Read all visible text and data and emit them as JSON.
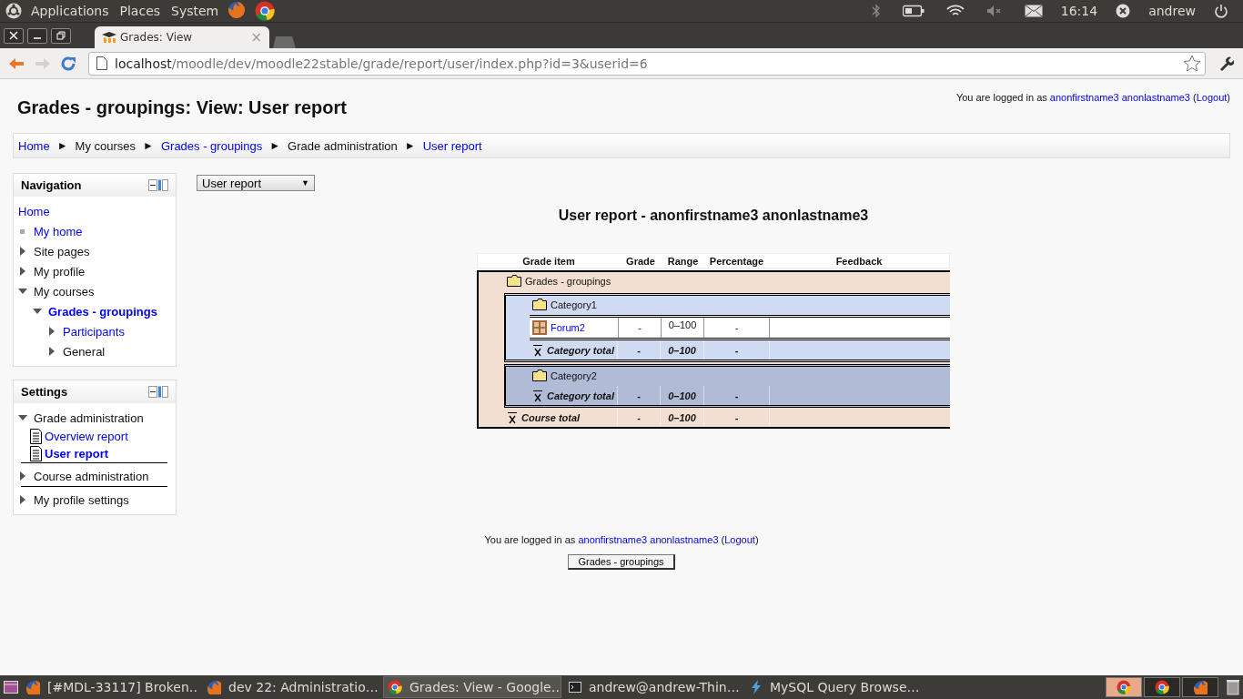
{
  "top_panel": {
    "menus": [
      "Applications",
      "Places",
      "System"
    ],
    "clock": "16:14",
    "user": "andrew"
  },
  "browser": {
    "tab_title": "Grades: View",
    "tab_close": "×",
    "url_host": "localhost",
    "url_path": "/moodle/dev/moodle22stable/grade/report/user/index.php?id=3&userid=6"
  },
  "page": {
    "title": "Grades - groupings: View: User report",
    "login": {
      "before": "You are logged in as ",
      "name": "anonfirstname3 anonlastname3",
      "open": " (",
      "logout": "Logout",
      "close": ")"
    },
    "breadcrumb": {
      "separator": "►",
      "items": [
        {
          "label": "Home",
          "link": true
        },
        {
          "label": "My courses",
          "link": false
        },
        {
          "label": "Grades - groupings",
          "link": true
        },
        {
          "label": "Grade administration",
          "link": false
        },
        {
          "label": "User report",
          "link": true
        }
      ]
    },
    "blocks": [
      {
        "title": "Navigation",
        "dividers": false,
        "items": [
          {
            "label": "Home",
            "kind": "plain",
            "link": true,
            "current": false
          },
          {
            "label": "My home",
            "kind": "leaf",
            "link": true,
            "current": false
          },
          {
            "label": "Site pages",
            "kind": "branch",
            "expanded": false,
            "link": false,
            "current": false
          },
          {
            "label": "My profile",
            "kind": "branch",
            "expanded": false,
            "link": false,
            "current": false
          },
          {
            "label": "My courses",
            "kind": "branch",
            "expanded": true,
            "link": false,
            "current": false,
            "children": [
              {
                "label": "Grades - groupings",
                "kind": "branch",
                "expanded": true,
                "link": true,
                "current": true,
                "children": [
                  {
                    "label": "Participants",
                    "kind": "branch",
                    "expanded": false,
                    "link": true,
                    "current": false
                  },
                  {
                    "label": "General",
                    "kind": "branch",
                    "expanded": false,
                    "link": false,
                    "current": false
                  }
                ]
              }
            ]
          }
        ]
      },
      {
        "title": "Settings",
        "dividers": true,
        "items": [
          {
            "label": "Grade administration",
            "kind": "branch",
            "expanded": true,
            "link": false,
            "current": false,
            "children": [
              {
                "label": "Overview report",
                "kind": "report",
                "link": true,
                "current": false
              },
              {
                "label": "User report",
                "kind": "report",
                "link": true,
                "current": true
              }
            ]
          },
          {
            "label": "Course administration",
            "kind": "branch",
            "expanded": false,
            "link": false,
            "current": false
          },
          {
            "label": "My profile settings",
            "kind": "branch",
            "expanded": false,
            "link": false,
            "current": false
          }
        ]
      }
    ],
    "report_select": {
      "value": "User report",
      "caret": "▼"
    },
    "heading": "User report - anonfirstname3 anonlastname3",
    "table": {
      "columns": [
        "Grade item",
        "Grade",
        "Range",
        "Percentage",
        "Feedback"
      ],
      "tree": {
        "kind": "category",
        "name": "Grades - groupings",
        "color": "#f3dfd1",
        "children": [
          {
            "kind": "category",
            "name": "Category1",
            "color": "#d0dbf1",
            "children": [
              {
                "kind": "item",
                "name": "Forum2",
                "grade": "-",
                "range": "0–100",
                "percentage": "-"
              }
            ],
            "total": {
              "name": "Category total",
              "grade": "-",
              "range": "0–100",
              "percentage": "-"
            }
          },
          {
            "kind": "category",
            "name": "Category2",
            "color": "#b0bbd6",
            "total": {
              "name": "Category total",
              "grade": "-",
              "range": "0–100",
              "percentage": "-"
            }
          }
        ],
        "total": {
          "name": "Course total",
          "grade": "-",
          "range": "0–100",
          "percentage": "-"
        }
      }
    },
    "footer": {
      "login": {
        "before": "You are logged in as ",
        "name": "anonfirstname3 anonlastname3",
        "open": " (",
        "logout": "Logout",
        "close": ")"
      },
      "button": "Grades - groupings"
    }
  },
  "taskbar": {
    "windows": [
      {
        "kind": "firefox",
        "label": "[#MDL-33117] Broken…",
        "selected": false
      },
      {
        "kind": "firefox",
        "label": "dev 22: Administratio…",
        "selected": false
      },
      {
        "kind": "chrome",
        "label": "Grades: View - Google…",
        "selected": true
      },
      {
        "kind": "terminal",
        "label": "andrew@andrew-Thin…",
        "selected": false
      },
      {
        "kind": "mysql",
        "label": "MySQL Query Browse…",
        "selected": false
      }
    ],
    "tray": [
      {
        "kind": "chrome",
        "selected": true
      },
      {
        "kind": "chrome",
        "selected": false
      },
      {
        "kind": "firefox",
        "selected": false
      }
    ]
  }
}
